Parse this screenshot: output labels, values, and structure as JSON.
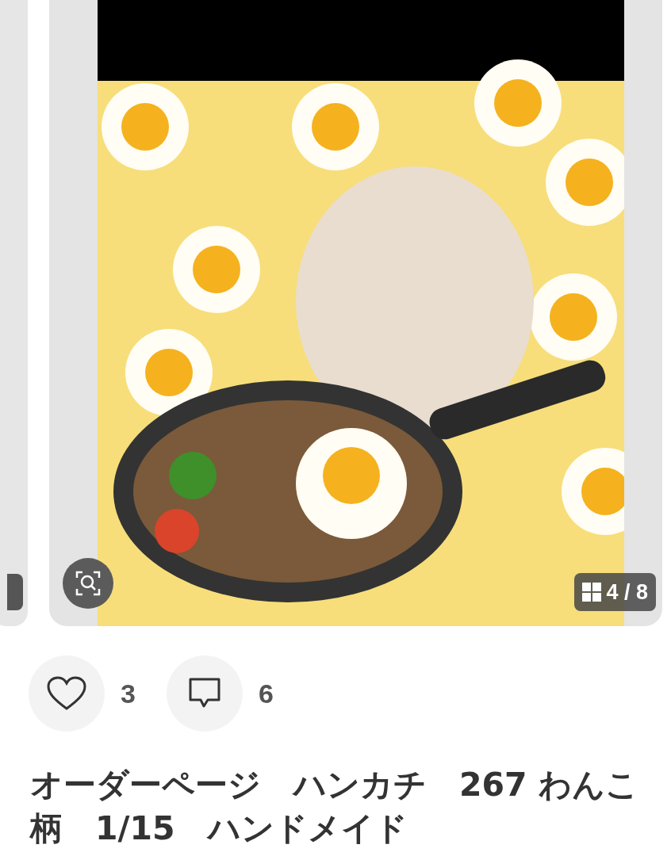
{
  "carousel": {
    "page_counter": "4 / 8"
  },
  "reactions": [
    {
      "kind": "like",
      "count": "3"
    },
    {
      "kind": "comment",
      "count": "6"
    }
  ],
  "title": "オーダーページ　ハンカチ　267 わんこ柄　1/15　ハンドメイド"
}
